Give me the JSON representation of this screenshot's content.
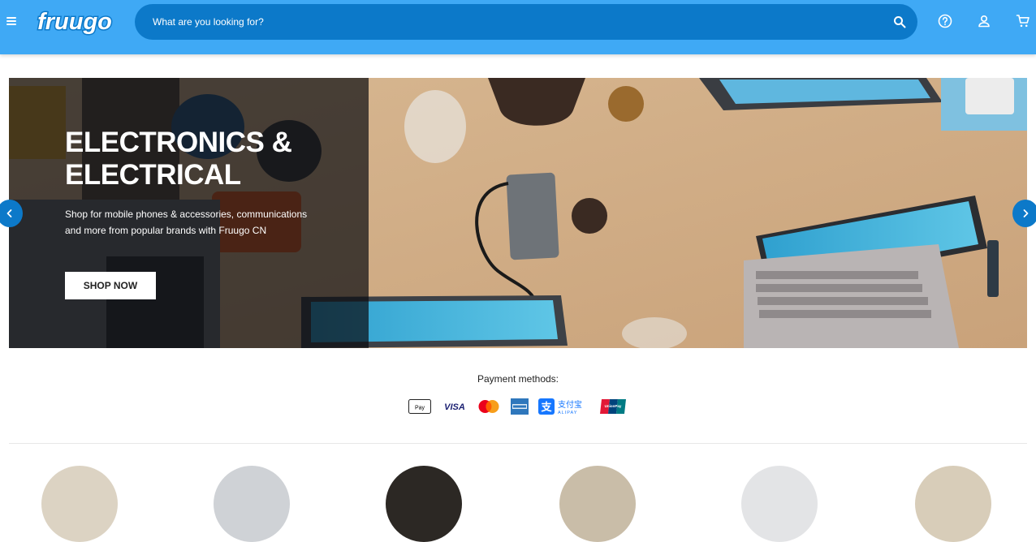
{
  "header": {
    "logo_text": "fruugo",
    "search_placeholder": "What are you looking for?",
    "icons": [
      "menu-icon",
      "search-icon",
      "help-icon",
      "account-icon",
      "cart-icon"
    ],
    "bg_color": "#3fa9f5",
    "search_bg_color": "#0c79c9"
  },
  "hero": {
    "title": "ELECTRONICS & ELECTRICAL",
    "subtitle": "Shop for mobile phones & accessories, communications and more from popular brands with Fruugo CN",
    "cta_label": "SHOP NOW",
    "prev_icon": "chevron-left-icon",
    "next_icon": "chevron-right-icon"
  },
  "payments": {
    "title": "Payment methods:",
    "methods": [
      {
        "name": "Apple Pay",
        "label": "Pay"
      },
      {
        "name": "Visa",
        "label": "VISA"
      },
      {
        "name": "Mastercard",
        "label": ""
      },
      {
        "name": "American Express",
        "label": ""
      },
      {
        "name": "Alipay",
        "label": "支付宝",
        "sublabel": "ALIPAY"
      },
      {
        "name": "UnionPay",
        "label": "UnionPay"
      }
    ]
  }
}
